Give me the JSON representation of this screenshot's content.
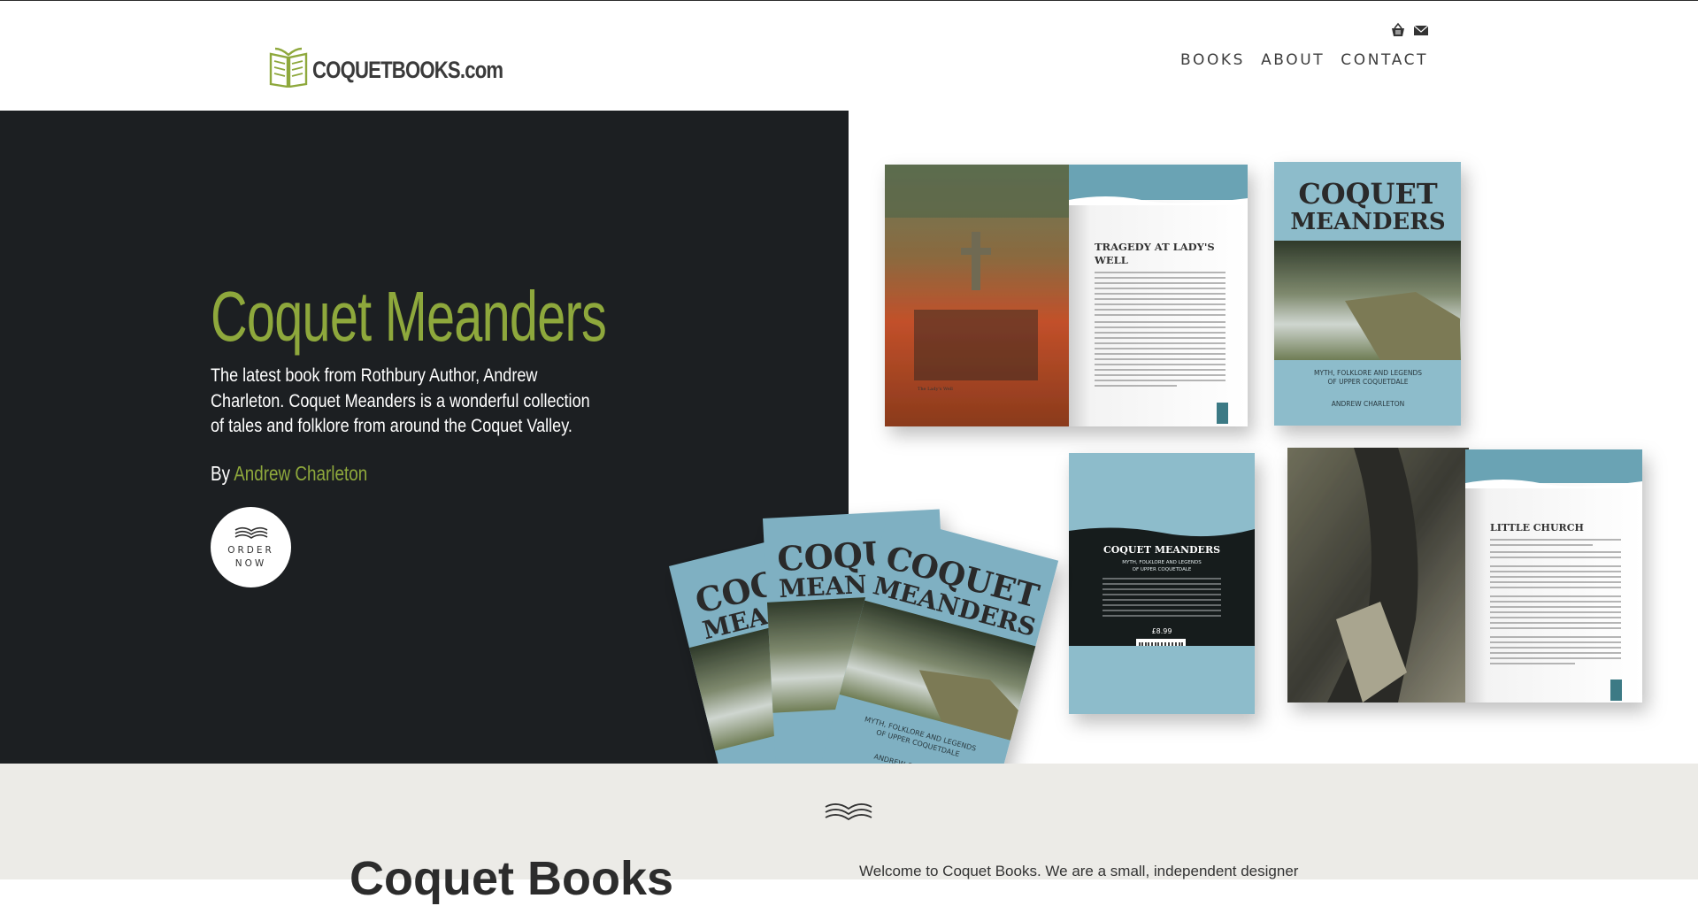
{
  "header": {
    "logo": {
      "text": "COQUETBOOKS.com",
      "icon": "open-book-logo-icon"
    },
    "utility_icons": [
      "basket-icon",
      "envelope-icon"
    ],
    "nav": [
      {
        "label": "BOOKS"
      },
      {
        "label": "ABOUT"
      },
      {
        "label": "CONTACT"
      }
    ]
  },
  "hero": {
    "title": "Coquet Meanders",
    "description": "The latest book from Rothbury Author, Andrew Charleton. Coquet Meanders is a wonderful collection of tales and folklore from around the Coquet Valley.",
    "by_prefix": "By",
    "author": "Andrew Charleton",
    "order_button": {
      "line1": "ORDER",
      "line2": "NOW",
      "icon": "open-book-icon"
    }
  },
  "book_images": {
    "spread1": {
      "heading_line1": "TRAGEDY AT LADY'S",
      "heading_line2": "WELL",
      "caption": "The Lady's Well"
    },
    "cover": {
      "title_line1": "COQUET",
      "title_line2": "MEANDERS",
      "subtitle_line1": "MYTH, FOLKLORE AND LEGENDS",
      "subtitle_line2": "OF UPPER COQUETDALE",
      "author": "ANDREW CHARLETON"
    },
    "back_cover": {
      "title": "COQUET MEANDERS",
      "subtitle_line1": "MYTH, FOLKLORE AND LEGENDS",
      "subtitle_line2": "OF UPPER COQUETDALE",
      "price": "£8.99"
    },
    "spread2": {
      "heading": "LITTLE CHURCH"
    }
  },
  "colors": {
    "accent": "#8ea83c",
    "dark": "#1c1f22",
    "band": "#ecebe7",
    "book_blue": "#7fb0c2"
  },
  "footer_band": {
    "icon": "open-book-icon",
    "heading": "Coquet Books",
    "text": "Welcome to Coquet Books. We are a small, independent designer"
  }
}
